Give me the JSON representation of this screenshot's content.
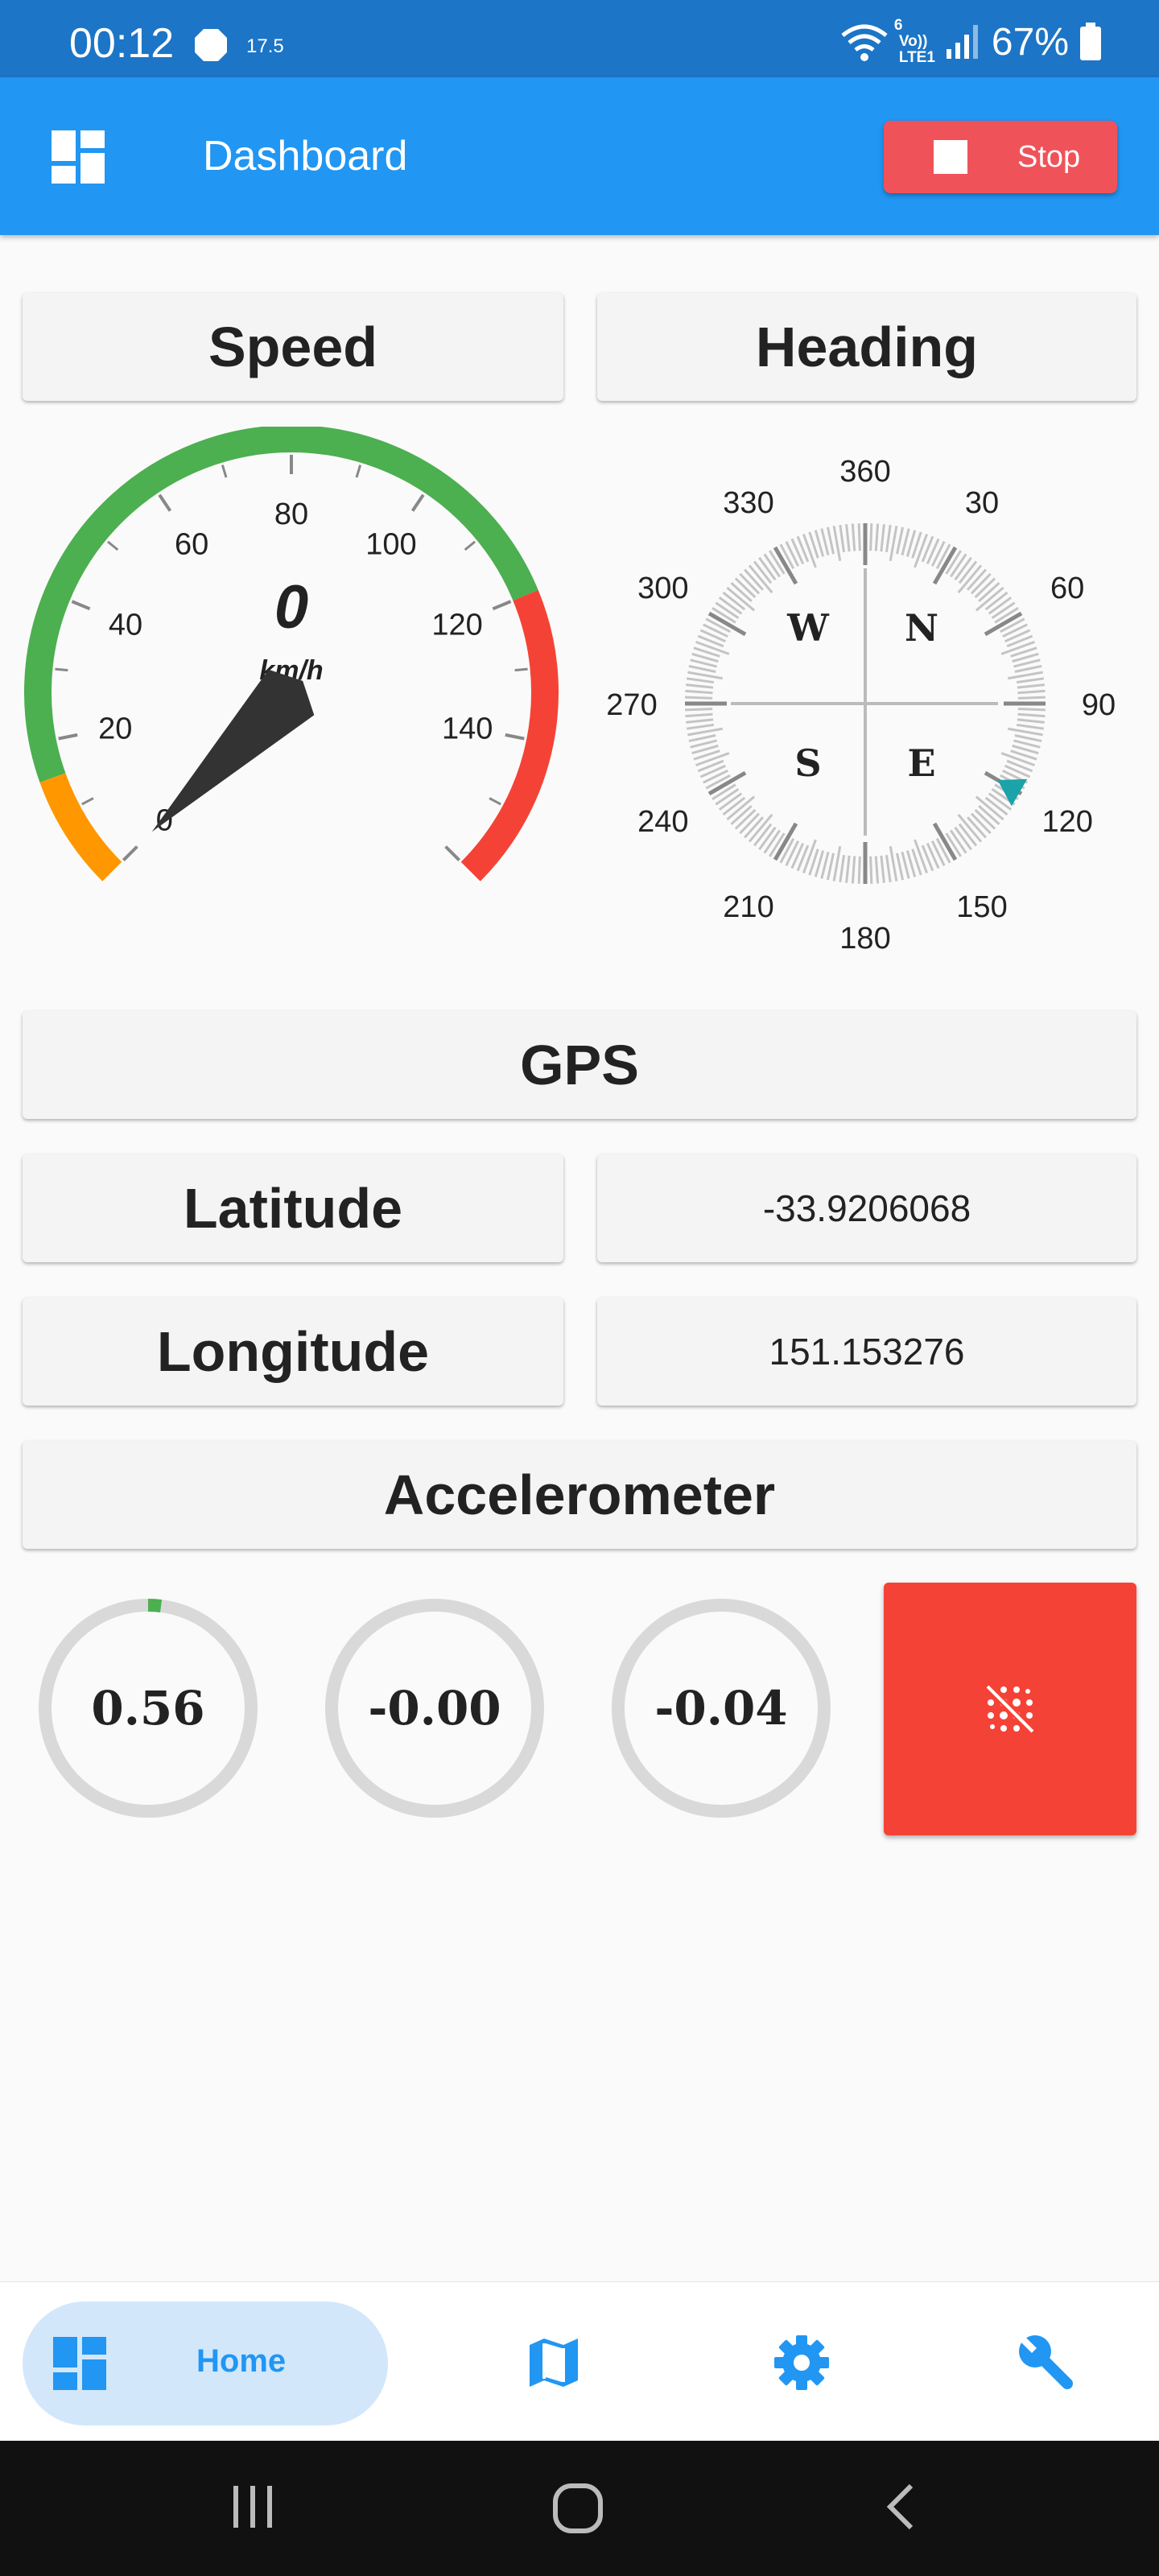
{
  "status_bar": {
    "time": "00:12",
    "small_text": "17.5",
    "network_top": "6",
    "network_volte": "Vo))",
    "network_lte": "LTE1",
    "battery": "67%"
  },
  "app_bar": {
    "title": "Dashboard",
    "stop_label": "Stop",
    "colors": {
      "primary": "#2196f3",
      "stop": "#f0525a"
    }
  },
  "sections": {
    "speed": "Speed",
    "heading": "Heading",
    "gps": "GPS",
    "latitude_label": "Latitude",
    "longitude_label": "Longitude",
    "accelerometer": "Accelerometer"
  },
  "gps": {
    "latitude": "-33.9206068",
    "longitude": "151.153276"
  },
  "speedometer": {
    "value": "0",
    "unit": "km/h",
    "min": 0,
    "max": 160,
    "current": 0,
    "tick_labels": [
      "0",
      "20",
      "40",
      "60",
      "80",
      "100",
      "120",
      "140"
    ],
    "ranges": [
      {
        "from": 0,
        "to": 15,
        "color": "#ff9800"
      },
      {
        "from": 15,
        "to": 120,
        "color": "#4caf50"
      },
      {
        "from": 120,
        "to": 160,
        "color": "#f44336"
      }
    ],
    "needle_color": "#333333"
  },
  "compass": {
    "cardinals": [
      "N",
      "E",
      "S",
      "W"
    ],
    "degree_labels": [
      "360",
      "30",
      "60",
      "90",
      "120",
      "150",
      "180",
      "210",
      "240",
      "270",
      "300",
      "330"
    ],
    "pointer_heading": 120,
    "pointer_color": "#1aa3a8"
  },
  "accelerometer": {
    "values": [
      "0.56",
      "-0.00",
      "-0.04"
    ],
    "progress": [
      0.02,
      0,
      0
    ],
    "progress_color": "#4caf50",
    "track_color": "#d9d9d9",
    "button_color": "#f44336"
  },
  "bottom_nav": {
    "home_label": "Home",
    "icons": [
      "dashboard-icon",
      "map-icon",
      "settings-icon",
      "wrench-icon"
    ]
  },
  "system_nav": {
    "icons": [
      "recents-icon",
      "home-icon",
      "back-icon"
    ]
  }
}
